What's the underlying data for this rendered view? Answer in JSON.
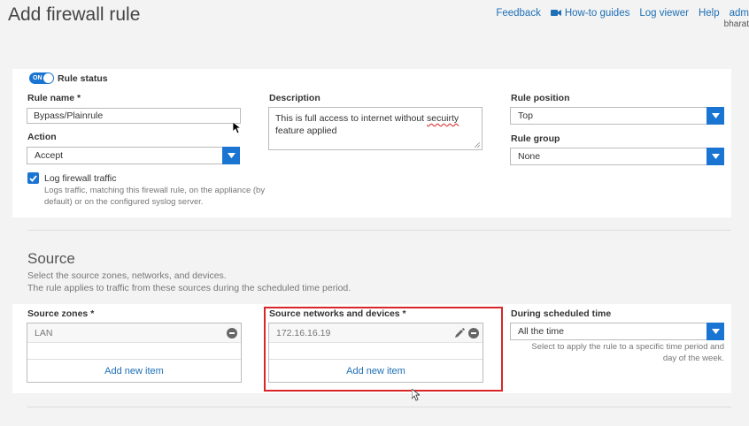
{
  "header": {
    "title": "Add firewall rule",
    "links": {
      "feedback": "Feedback",
      "howto": "How-to guides",
      "logviewer": "Log viewer",
      "help": "Help",
      "user": "adm"
    },
    "user_sub": "bharat"
  },
  "rule": {
    "status_toggle": "ON",
    "status_label": "Rule status",
    "name_label": "Rule name *",
    "name_value": "Bypass/Plainrule",
    "action_label": "Action",
    "action_value": "Accept",
    "log_label": "Log firewall traffic",
    "log_checked": true,
    "log_desc_1": "Logs traffic, matching this firewall rule, on the appliance (by",
    "log_desc_2": "default) or on the configured syslog server.",
    "description_label": "Description",
    "description_value_1": "This is full access to internet without",
    "description_value_misspelled": "secuirty",
    "description_value_2": "feature applied",
    "position_label": "Rule position",
    "position_value": "Top",
    "group_label": "Rule group",
    "group_value": "None"
  },
  "source": {
    "title": "Source",
    "desc_1": "Select the source zones, networks, and devices.",
    "desc_2": "The rule applies to traffic from these sources during the scheduled time period.",
    "zones_label": "Source zones *",
    "zones_items": [
      "LAN"
    ],
    "zones_add": "Add new item",
    "networks_label": "Source networks and devices *",
    "networks_items": [
      "172.16.16.19"
    ],
    "networks_add": "Add new item",
    "schedule_label": "During scheduled time",
    "schedule_value": "All the time",
    "schedule_desc_1": "Select to apply the rule to a specific time period and",
    "schedule_desc_2": "day of the week."
  },
  "colors": {
    "accent": "#1a74d2",
    "link": "#1e6fb5",
    "highlight": "#d9262a"
  }
}
